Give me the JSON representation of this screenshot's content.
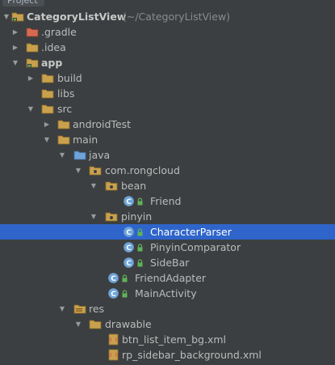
{
  "header": {
    "title": "Project"
  },
  "tree": {
    "project_name": "CategoryListView",
    "project_path": "(~/CategoryListView)",
    "items": [
      {
        "label": ".gradle"
      },
      {
        "label": ".idea"
      },
      {
        "label": "app"
      },
      {
        "label": "build"
      },
      {
        "label": "libs"
      },
      {
        "label": "src"
      },
      {
        "label": "androidTest"
      },
      {
        "label": "main"
      },
      {
        "label": "java"
      },
      {
        "label": "com.rongcloud"
      },
      {
        "label": "bean"
      },
      {
        "label": "Friend"
      },
      {
        "label": "pinyin"
      },
      {
        "label": "CharacterParser"
      },
      {
        "label": "PinyinComparator"
      },
      {
        "label": "SideBar"
      },
      {
        "label": "FriendAdapter"
      },
      {
        "label": "MainActivity"
      },
      {
        "label": "res"
      },
      {
        "label": "drawable"
      },
      {
        "label": "btn_list_item_bg.xml"
      },
      {
        "label": "rp_sidebar_background.xml"
      }
    ]
  },
  "colors": {
    "background": "#3c3f41",
    "selection": "#2f65ca",
    "folder": "#c9a14e",
    "class_icon": "#6ea4d8",
    "access_lock": "#5fb357",
    "module_marker": "#5fb357",
    "excluded_marker": "#d46a52"
  },
  "icons": {
    "expanded": "triangle-down-icon",
    "collapsed": "triangle-right-icon",
    "folder": "folder-icon",
    "source_folder": "source-folder-icon",
    "package": "package-icon",
    "class": "class-icon",
    "access": "lock-icon",
    "xml": "xml-file-icon"
  }
}
